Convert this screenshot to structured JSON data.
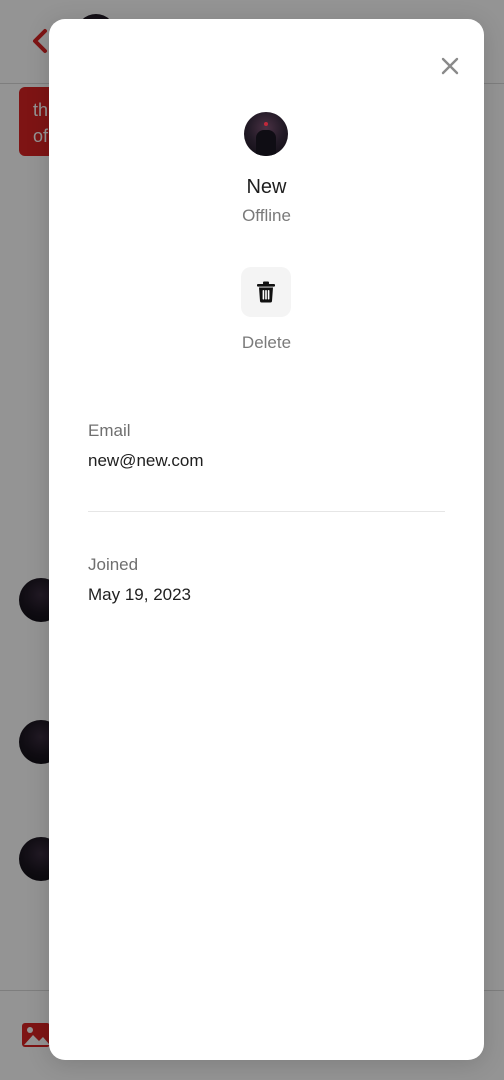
{
  "background": {
    "bubble_text_line1": "th",
    "bubble_text_line2": "of"
  },
  "colors": {
    "accent": "#d92323",
    "overlay": "#000000",
    "muted_text": "#7a7a7a"
  },
  "icons": {
    "back": "chevron-left-icon",
    "close": "close-icon",
    "delete": "trash-icon",
    "image": "image-icon"
  },
  "profile": {
    "name": "New",
    "status": "Offline",
    "delete_label": "Delete"
  },
  "details": {
    "email_label": "Email",
    "email_value": "new@new.com",
    "joined_label": "Joined",
    "joined_value": "May 19, 2023"
  }
}
